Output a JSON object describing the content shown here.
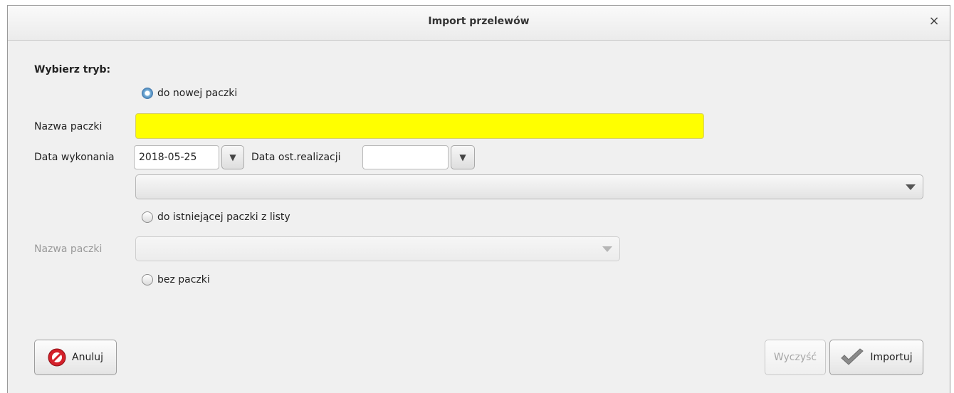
{
  "window": {
    "title": "Import przelewów",
    "close_icon": "×"
  },
  "form": {
    "mode_heading": "Wybierz tryb:",
    "option_new": "do nowej paczki",
    "package_name_label": "Nazwa paczki",
    "package_name_value": "",
    "execution_date_label": "Data wykonania",
    "execution_date_value": "2018-05-25",
    "last_realization_label": "Data ost.realizacji",
    "last_realization_value": "",
    "new_package_combo_value": "",
    "option_existing": "do istniejącej paczki z listy",
    "existing_package_label": "Nazwa paczki",
    "existing_package_value": "",
    "option_none": "bez paczki",
    "selected_option": "do nowej paczki"
  },
  "buttons": {
    "cancel": "Anuluj",
    "clear": "Wyczyść",
    "import": "Importuj"
  },
  "colors": {
    "required_field": "#ffff00",
    "cancel_icon": "#d4202a",
    "import_check": "#8a8a8a"
  }
}
